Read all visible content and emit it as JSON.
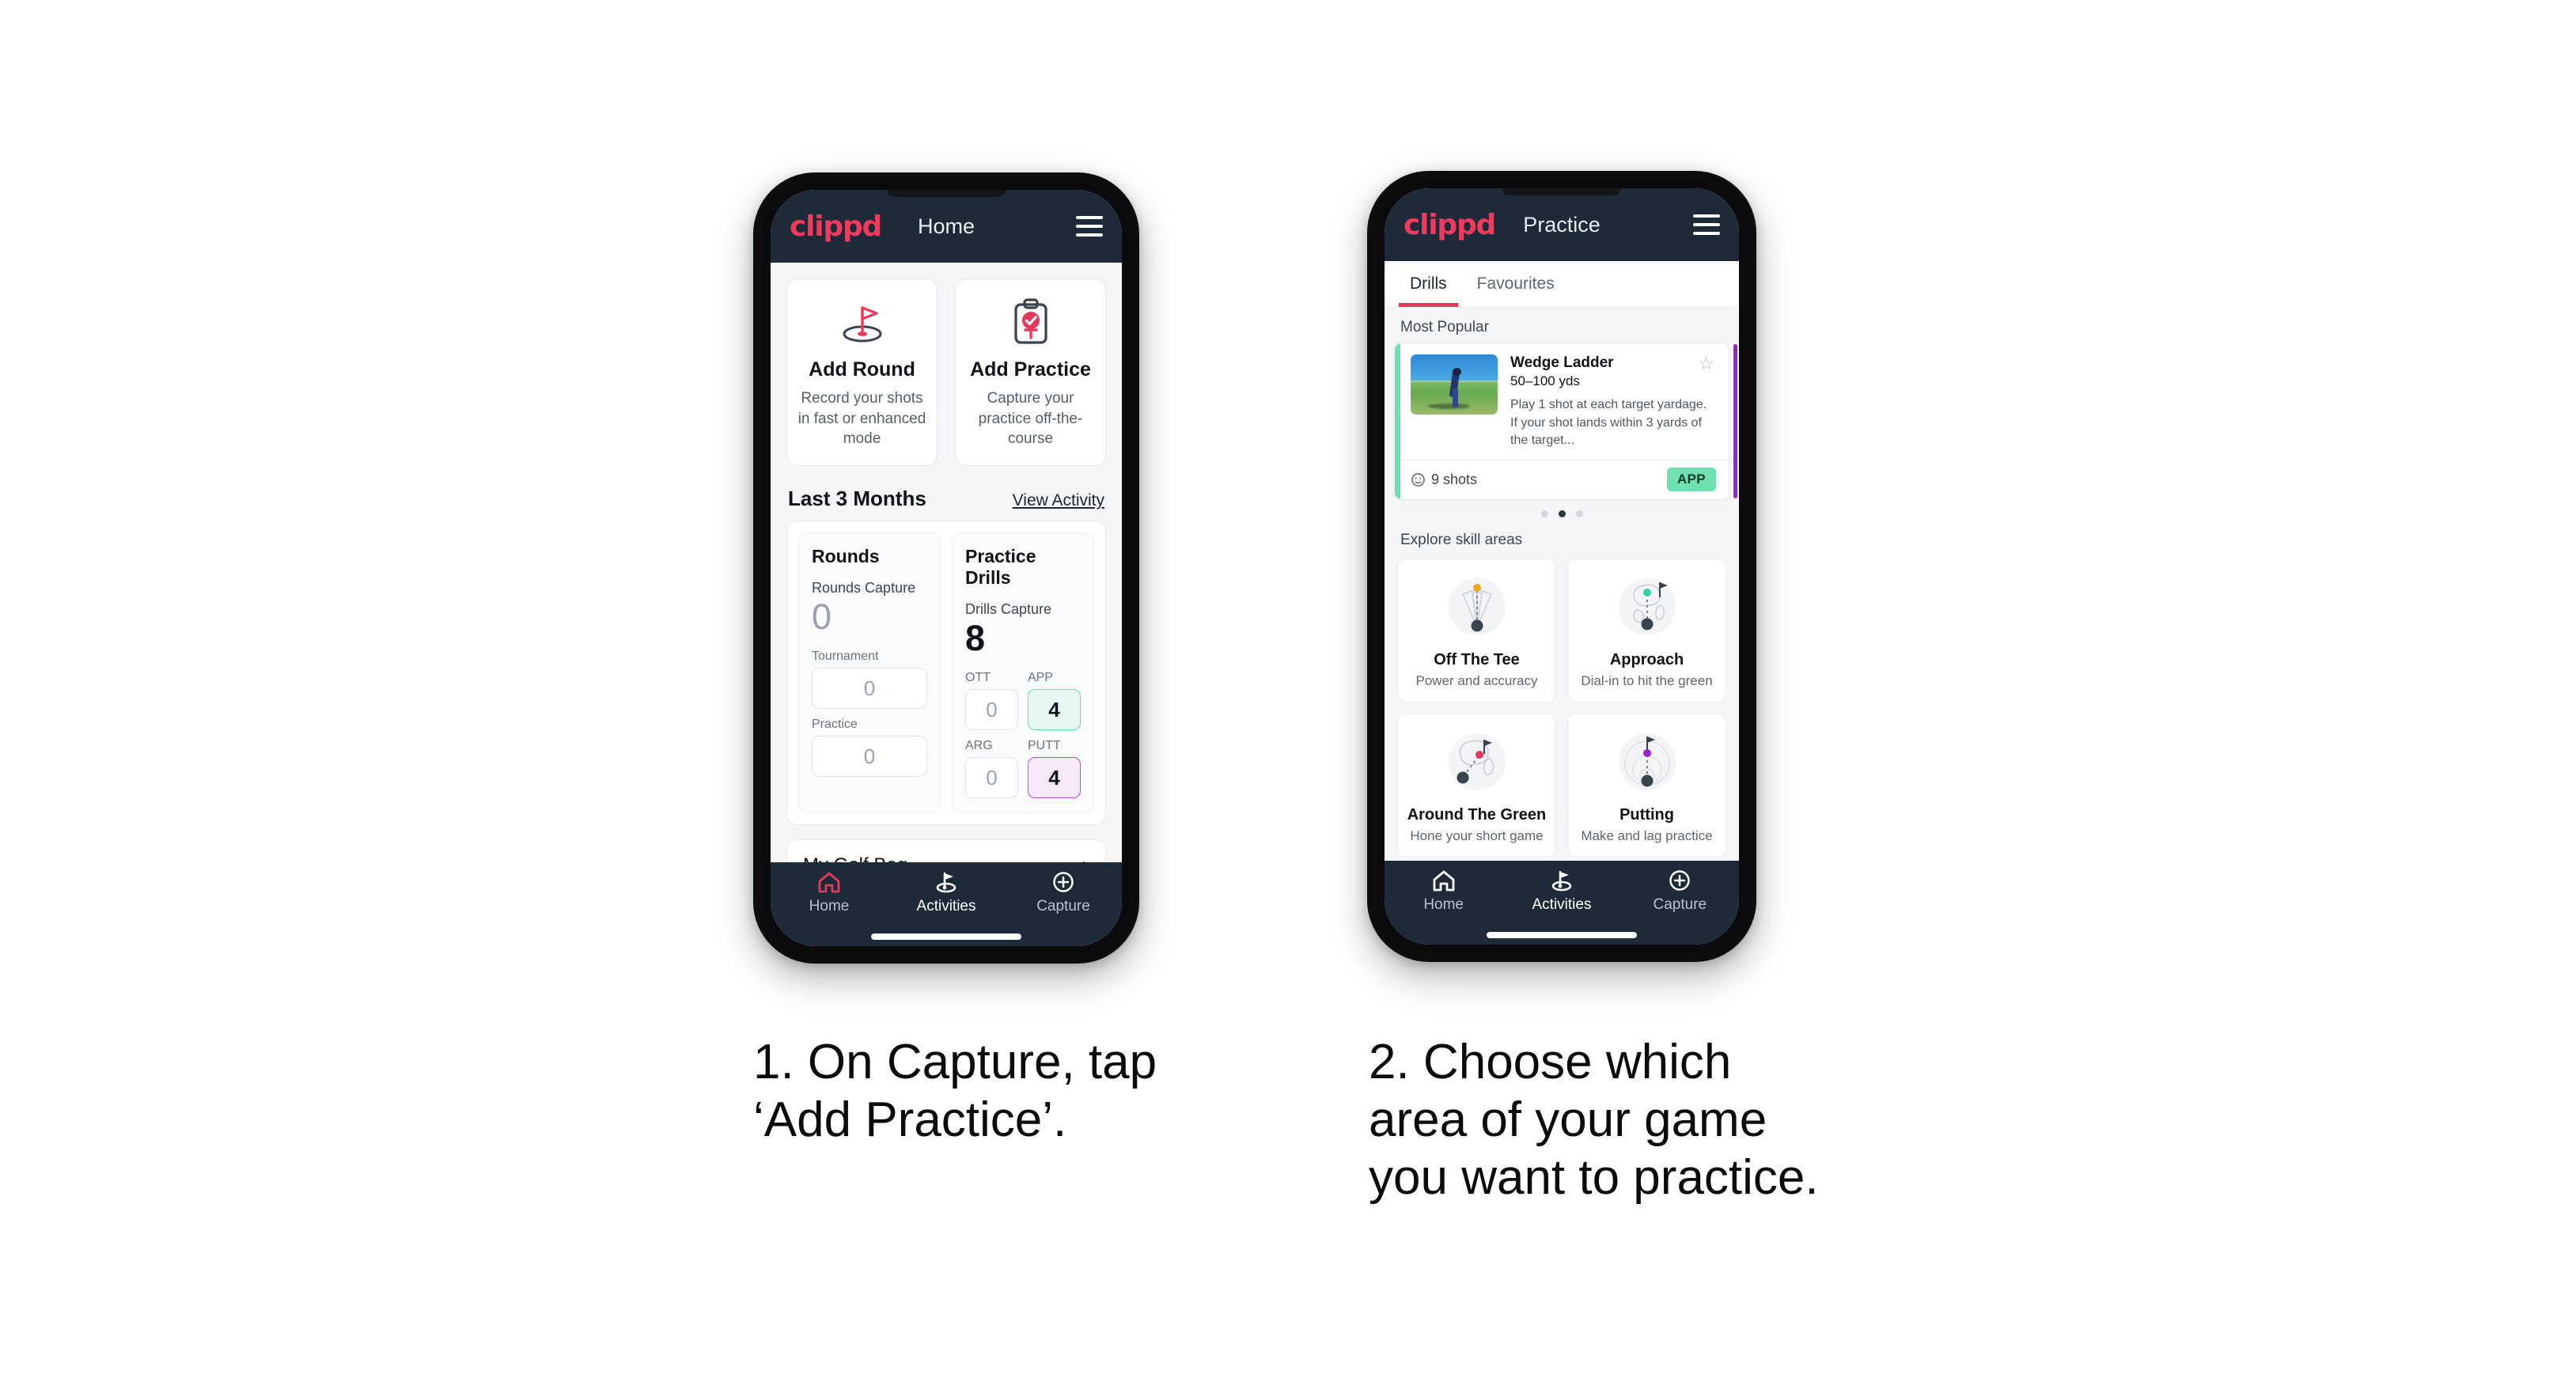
{
  "phones": [
    {
      "id": "phone-home",
      "appbar": {
        "logo": "clippd",
        "title": "Home",
        "menu_icon": "hamburger-icon"
      },
      "quick_actions": [
        {
          "icon": "golf-flag-hole-icon",
          "title": "Add Round",
          "desc": "Record your shots in fast or enhanced mode"
        },
        {
          "icon": "clipboard-check-tee-icon",
          "title": "Add Practice",
          "desc": "Capture your practice off-the-course"
        }
      ],
      "section": {
        "heading": "Last 3 Months",
        "link": "View Activity"
      },
      "stats": [
        {
          "title": "Rounds",
          "capture_label": "Rounds Capture",
          "capture_value": "0",
          "capture_is_zero": true,
          "minis": [
            {
              "label": "Tournament",
              "value": "0",
              "state": "empty",
              "full": true
            },
            {
              "label": "Practice",
              "value": "0",
              "state": "empty",
              "full": true
            }
          ]
        },
        {
          "title": "Practice Drills",
          "capture_label": "Drills Capture",
          "capture_value": "8",
          "capture_is_zero": false,
          "minis": [
            {
              "label": "OTT",
              "value": "0",
              "state": "empty",
              "full": false
            },
            {
              "label": "APP",
              "value": "4",
              "state": "green",
              "full": false
            },
            {
              "label": "ARG",
              "value": "0",
              "state": "empty",
              "full": false
            },
            {
              "label": "PUTT",
              "value": "4",
              "state": "purple",
              "full": false
            }
          ]
        }
      ],
      "bag_row": {
        "label": "My Golf Bag",
        "chevron": "chevron-right-icon"
      },
      "tabbar": [
        {
          "icon": "home-icon",
          "label": "Home",
          "active": true
        },
        {
          "icon": "golf-flag-icon",
          "label": "Activities",
          "active": false
        },
        {
          "icon": "plus-circle-icon",
          "label": "Capture",
          "active": false
        }
      ]
    },
    {
      "id": "phone-practice",
      "appbar": {
        "logo": "clippd",
        "title": "Practice",
        "menu_icon": "hamburger-icon"
      },
      "tabs": [
        {
          "label": "Drills",
          "active": true
        },
        {
          "label": "Favourites",
          "active": false
        }
      ],
      "most_popular_label": "Most Popular",
      "drill": {
        "title": "Wedge Ladder",
        "yardage": "50–100 yds",
        "description": "Play 1 shot at each target yardage. If your shot lands within 3 yards of the target...",
        "shots": "9 shots",
        "shots_icon": "clock-icon",
        "badge": "APP",
        "favourite_icon": "star-outline-icon",
        "accent_color": "#6fe0b0",
        "thumbnail": "golfer-chipping-photo"
      },
      "dots": [
        {
          "active": false
        },
        {
          "active": true
        },
        {
          "active": false
        }
      ],
      "explore_label": "Explore skill areas",
      "skills": [
        {
          "icon": "off-the-tee-icon",
          "title": "Off The Tee",
          "desc": "Power and accuracy",
          "dot_color": "#f2a81d"
        },
        {
          "icon": "approach-icon",
          "title": "Approach",
          "desc": "Dial-in to hit the green",
          "dot_color": "#2fd4a8"
        },
        {
          "icon": "around-the-green-icon",
          "title": "Around The Green",
          "desc": "Hone your short game",
          "dot_color": "#e23a5e"
        },
        {
          "icon": "putting-icon",
          "title": "Putting",
          "desc": "Make and lag practice",
          "dot_color": "#9b1fd6"
        }
      ],
      "tabbar": [
        {
          "icon": "home-icon",
          "label": "Home",
          "active": false
        },
        {
          "icon": "golf-flag-icon",
          "label": "Activities",
          "active": true
        },
        {
          "icon": "plus-circle-icon",
          "label": "Capture",
          "active": false
        }
      ]
    }
  ],
  "captions": [
    {
      "text": "1. On Capture, tap\n‘Add Practice’."
    },
    {
      "text": "2. Choose which\narea of your game\nyou want to practice."
    }
  ],
  "colors": {
    "brand_pink": "#ee3a5d",
    "appbar_dark": "#1e2a38",
    "mint": "#6fe0b0",
    "purple": "#9b1fd6"
  }
}
